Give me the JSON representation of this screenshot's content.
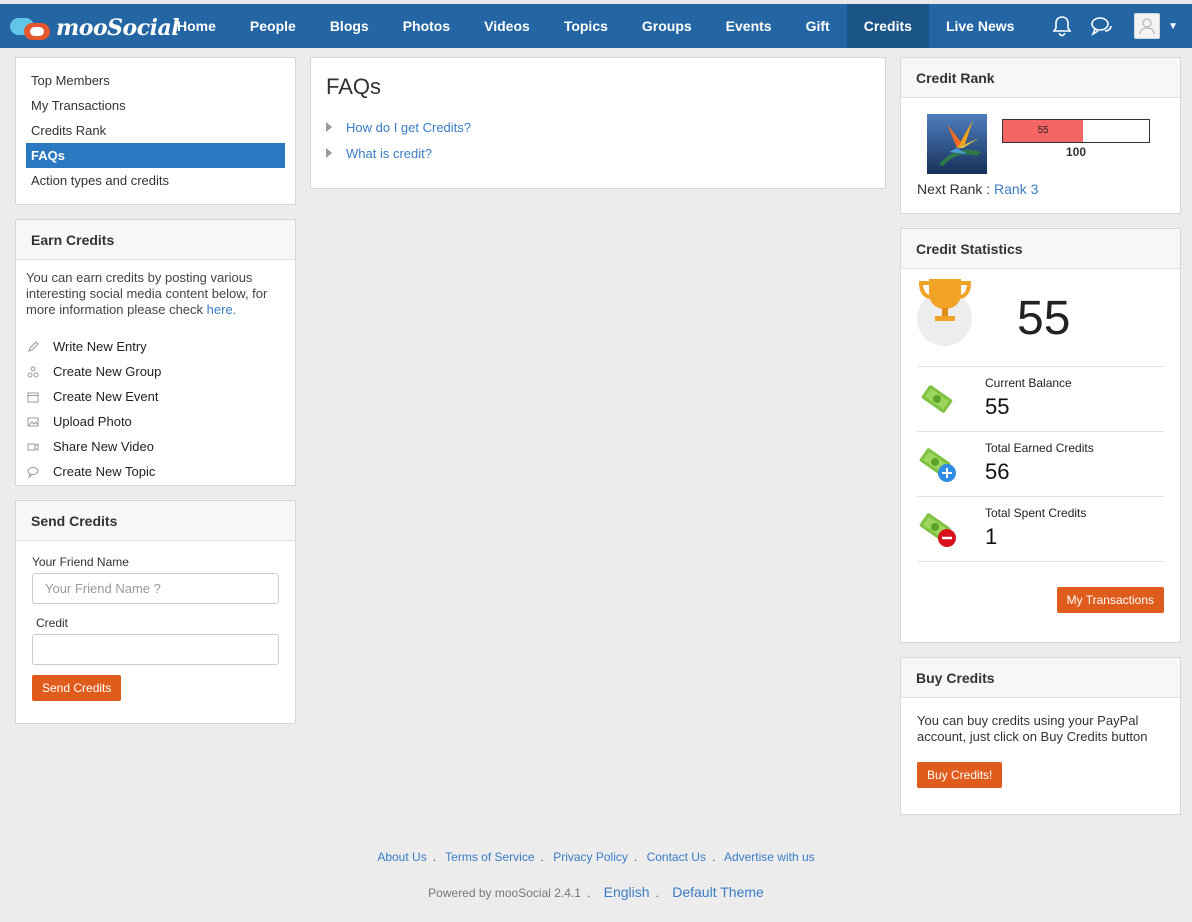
{
  "brand": {
    "logo_text": "mooSocial"
  },
  "nav": {
    "items": [
      "Home",
      "People",
      "Blogs",
      "Photos",
      "Videos",
      "Topics",
      "Groups",
      "Events",
      "Gift",
      "Credits",
      "Live News"
    ],
    "active": "Credits"
  },
  "topbar_icons": [
    "bell-icon",
    "chat-icon",
    "avatar",
    "chevron-down-icon"
  ],
  "left_menu": {
    "items": [
      "Top Members",
      "My Transactions",
      "Credits Rank",
      "FAQs",
      "Action types and credits"
    ],
    "active": "FAQs"
  },
  "earn_credits": {
    "title": "Earn Credits",
    "text": "You can earn credits by posting various interesting social media content below, for more information please check",
    "link": "here.",
    "actions": [
      {
        "label": "Write New Entry",
        "icon": "pencil-icon"
      },
      {
        "label": "Create New Group",
        "icon": "group-icon"
      },
      {
        "label": "Create New Event",
        "icon": "calendar-icon"
      },
      {
        "label": "Upload Photo",
        "icon": "image-icon"
      },
      {
        "label": "Share New Video",
        "icon": "video-icon"
      },
      {
        "label": "Create New Topic",
        "icon": "comment-icon"
      }
    ]
  },
  "send_credits": {
    "title": "Send Credits",
    "friend_label": "Your Friend Name",
    "friend_placeholder": "Your Friend Name ?",
    "credit_label": "Credit",
    "credit_value": "",
    "button": "Send Credits"
  },
  "faqs": {
    "title": "FAQs",
    "items": [
      "How do I get Credits?",
      "What is credit?"
    ]
  },
  "credit_rank": {
    "title": "Credit Rank",
    "current": "55",
    "max": "100",
    "progress_fraction": 0.55,
    "next_rank_label": "Next Rank :",
    "next_rank_value": "Rank 3"
  },
  "credit_statistics": {
    "title": "Credit Statistics",
    "total": "55",
    "rows": [
      {
        "label": "Current Balance",
        "value": "55",
        "icon": "money-icon"
      },
      {
        "label": "Total Earned Credits",
        "value": "56",
        "icon": "money-plus-icon"
      },
      {
        "label": "Total Spent Credits",
        "value": "1",
        "icon": "money-minus-icon"
      }
    ],
    "button": "My Transactions"
  },
  "buy_credits": {
    "title": "Buy Credits",
    "text": "You can buy credits using your PayPal account, just click on Buy Credits button",
    "button": "Buy Credits!"
  },
  "footer": {
    "links": [
      "About Us",
      "Terms of Service",
      "Privacy Policy",
      "Contact Us",
      "Advertise with us"
    ],
    "powered": "Powered by mooSocial 2.4.1",
    "language": "English",
    "theme": "Default Theme"
  },
  "colors": {
    "topbar": "#2466a3",
    "topbar_active": "#1b5587",
    "menu_active": "#2a79c0",
    "button": "#e05c1c",
    "progress_fill": "#f56565",
    "link": "#3a7cc6"
  }
}
